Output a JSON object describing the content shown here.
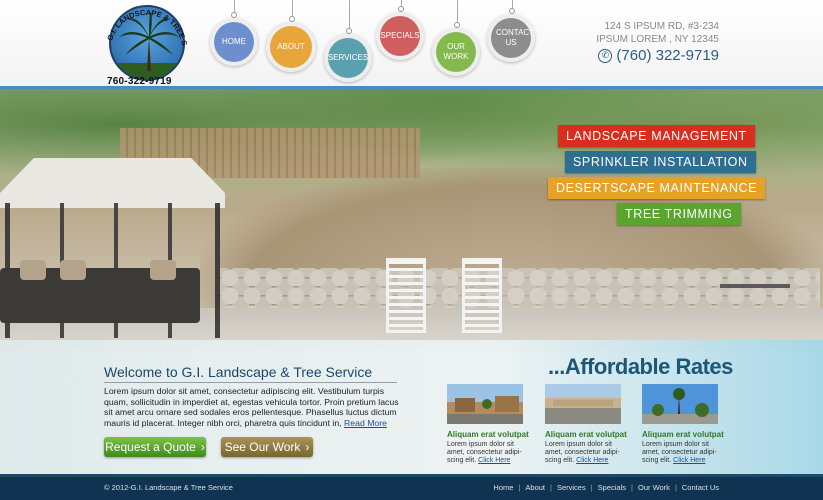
{
  "header": {
    "logo_text": "G.I. LANDSCAPE & TREE SERVICE",
    "logo_phone": "760-322-9719",
    "address_line1": "124 S IPSUM RD, #3-234",
    "address_line2": "IPSUM LOREM , NY 12345",
    "phone": "(760) 322-9719",
    "nav": [
      {
        "label": "HOME",
        "color": "#6d8fce"
      },
      {
        "label": "ABOUT",
        "color": "#e8a53a"
      },
      {
        "label": "SERVICES",
        "color": "#5aa0ad"
      },
      {
        "label": "SPECIALS",
        "color": "#cf5f5f"
      },
      {
        "label": "OUR WORK",
        "color": "#83b94d"
      },
      {
        "label": "CONTACT US",
        "color": "#8d8d8d"
      }
    ]
  },
  "services": [
    {
      "label": "LANDSCAPE MANAGEMENT",
      "color": "#d92d1f"
    },
    {
      "label": "SPRINKLER INSTALLATION",
      "color": "#2d6e91"
    },
    {
      "label": "DESERTSCAPE MAINTENANCE",
      "color": "#e6a227"
    },
    {
      "label": "TREE TRIMMING",
      "color": "#5aa52d"
    }
  ],
  "welcome": {
    "title": "Welcome to G.I. Landscape & Tree Service",
    "text": "Lorem ipsum dolor sit amet, consectetur adipiscing elit. Vestibulum turpis quam, sollicitudin in imperdiet at, egestas vehicula tortor. Proin pretium lacus sit amet arcu ornare sed sodales eros pellentesque. Phasellus luctus dictum mauris id placerat. Integer nibh orci, pharetra quis tincidunt in,",
    "read_more": "Read More"
  },
  "buttons": {
    "quote": "Request a Quote",
    "work": "See Our Work",
    "arrow": "›"
  },
  "rates_title": "...Affordable Rates",
  "cards": [
    {
      "title": "Aliquam erat volutpat",
      "text": "Lorem ipsum dolor sit amet, consectetur adipi-scing elit.",
      "link": "Click Here"
    },
    {
      "title": "Aliquam erat volutpat",
      "text": "Lorem ipsum dolor sit amet, consectetur adipi-scing elit.",
      "link": "Click Here"
    },
    {
      "title": "Aliquam erat volutpat",
      "text": "Lorem ipsum dolor sit amet, consectetur adipi-scing elit.",
      "link": "Click Here"
    }
  ],
  "footer": {
    "copyright": "© 2012-G.I. Landscape & Tree Service",
    "nav": [
      "Home",
      "About",
      "Services",
      "Specials",
      "Our Work",
      "Contact Us"
    ],
    "separator": "|"
  }
}
